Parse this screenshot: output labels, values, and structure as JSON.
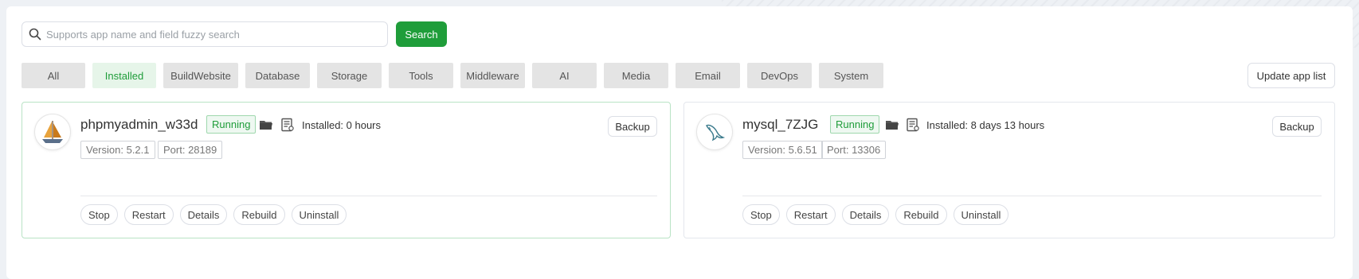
{
  "search": {
    "placeholder": "Supports app name and field fuzzy search",
    "value": "",
    "button_label": "Search",
    "icon": "search-icon"
  },
  "tabs": [
    {
      "label": "All",
      "active": false
    },
    {
      "label": "Installed",
      "active": true
    },
    {
      "label": "BuildWebsite",
      "active": false
    },
    {
      "label": "Database",
      "active": false
    },
    {
      "label": "Storage",
      "active": false
    },
    {
      "label": "Tools",
      "active": false
    },
    {
      "label": "Middleware",
      "active": false
    },
    {
      "label": "AI",
      "active": false
    },
    {
      "label": "Media",
      "active": false
    },
    {
      "label": "Email",
      "active": false
    },
    {
      "label": "DevOps",
      "active": false
    },
    {
      "label": "System",
      "active": false
    }
  ],
  "update_button": "Update app list",
  "apps": [
    {
      "name": "phpmyadmin_w33d",
      "status": "Running",
      "installed": "Installed: 0 hours",
      "version": "Version: 5.2.1",
      "port": "Port: 28189",
      "backup_label": "Backup",
      "logo": "sailboat-icon",
      "actions": [
        "Stop",
        "Restart",
        "Details",
        "Rebuild",
        "Uninstall"
      ]
    },
    {
      "name": "mysql_7ZJG",
      "status": "Running",
      "installed": "Installed: 8 days 13 hours",
      "version": "Version: 5.6.51",
      "port": "Port: 13306",
      "backup_label": "Backup",
      "logo": "dolphin-icon",
      "actions": [
        "Stop",
        "Restart",
        "Details",
        "Rebuild",
        "Uninstall"
      ]
    }
  ],
  "colors": {
    "accent": "#1f9d3a",
    "active_tab_bg": "#e6f5e9",
    "badge_border": "#9ed7ad"
  }
}
